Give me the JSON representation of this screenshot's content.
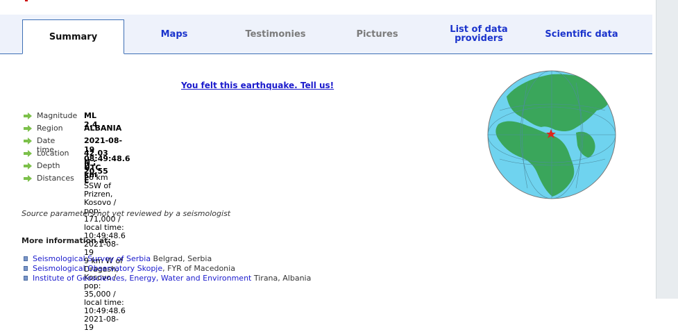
{
  "tabs": [
    {
      "label": "Summary",
      "state": "active"
    },
    {
      "label": "Maps",
      "state": "link"
    },
    {
      "label": "Testimonies",
      "state": "disabled"
    },
    {
      "label": "Pictures",
      "state": "disabled"
    },
    {
      "label": "List of data providers",
      "state": "link"
    },
    {
      "label": "Scientific data",
      "state": "link"
    }
  ],
  "felt_link": "You felt this earthquake. Tell us!",
  "params": [
    {
      "label": "Magnitude",
      "value": "ML 2.4"
    },
    {
      "label": "Region",
      "value": "ALBANIA"
    },
    {
      "label": "Date time",
      "value": "2021-08-19 08:49:48.6 UTC"
    },
    {
      "label": "Location",
      "value": "42.03 N ; 20.55 E"
    },
    {
      "label": "Depth",
      "value": "2 km"
    }
  ],
  "distances": {
    "label": "Distances",
    "lines": [
      "26 km SSW of Prizren, Kosovo / pop: 171,000 / local time: 10:49:48.6 2021-08-19",
      "9 km W of Dragash, Kosovo / pop: 35,000 / local time: 10:49:48.6 2021-08-19"
    ]
  },
  "source_note": "Source parameters not yet reviewed by a seismologist",
  "more_info_title": "More information at:",
  "info_links": [
    {
      "name": "Seismological Survey of Serbia",
      "place": " Belgrad, Serbia"
    },
    {
      "name": "Seismological Observatory Skopje",
      "place": ", FYR of Macedonia"
    },
    {
      "name": "Institute of Geosciences, Energy, Water and Environment",
      "place": " Tirana, Albania"
    }
  ],
  "icons": {
    "param_bullet": "green-arrow-icon",
    "link_bullet": "square-bullet-icon",
    "epicenter": "red-star-icon"
  },
  "colors": {
    "tab_link": "#1a33cc",
    "tab_disabled": "#7b7b7b",
    "tab_border": "#3d6fb5",
    "arrow": "#7cc04a",
    "ocean": "#6fd3ef",
    "land": "#3aa65b",
    "star": "#e0241b"
  }
}
